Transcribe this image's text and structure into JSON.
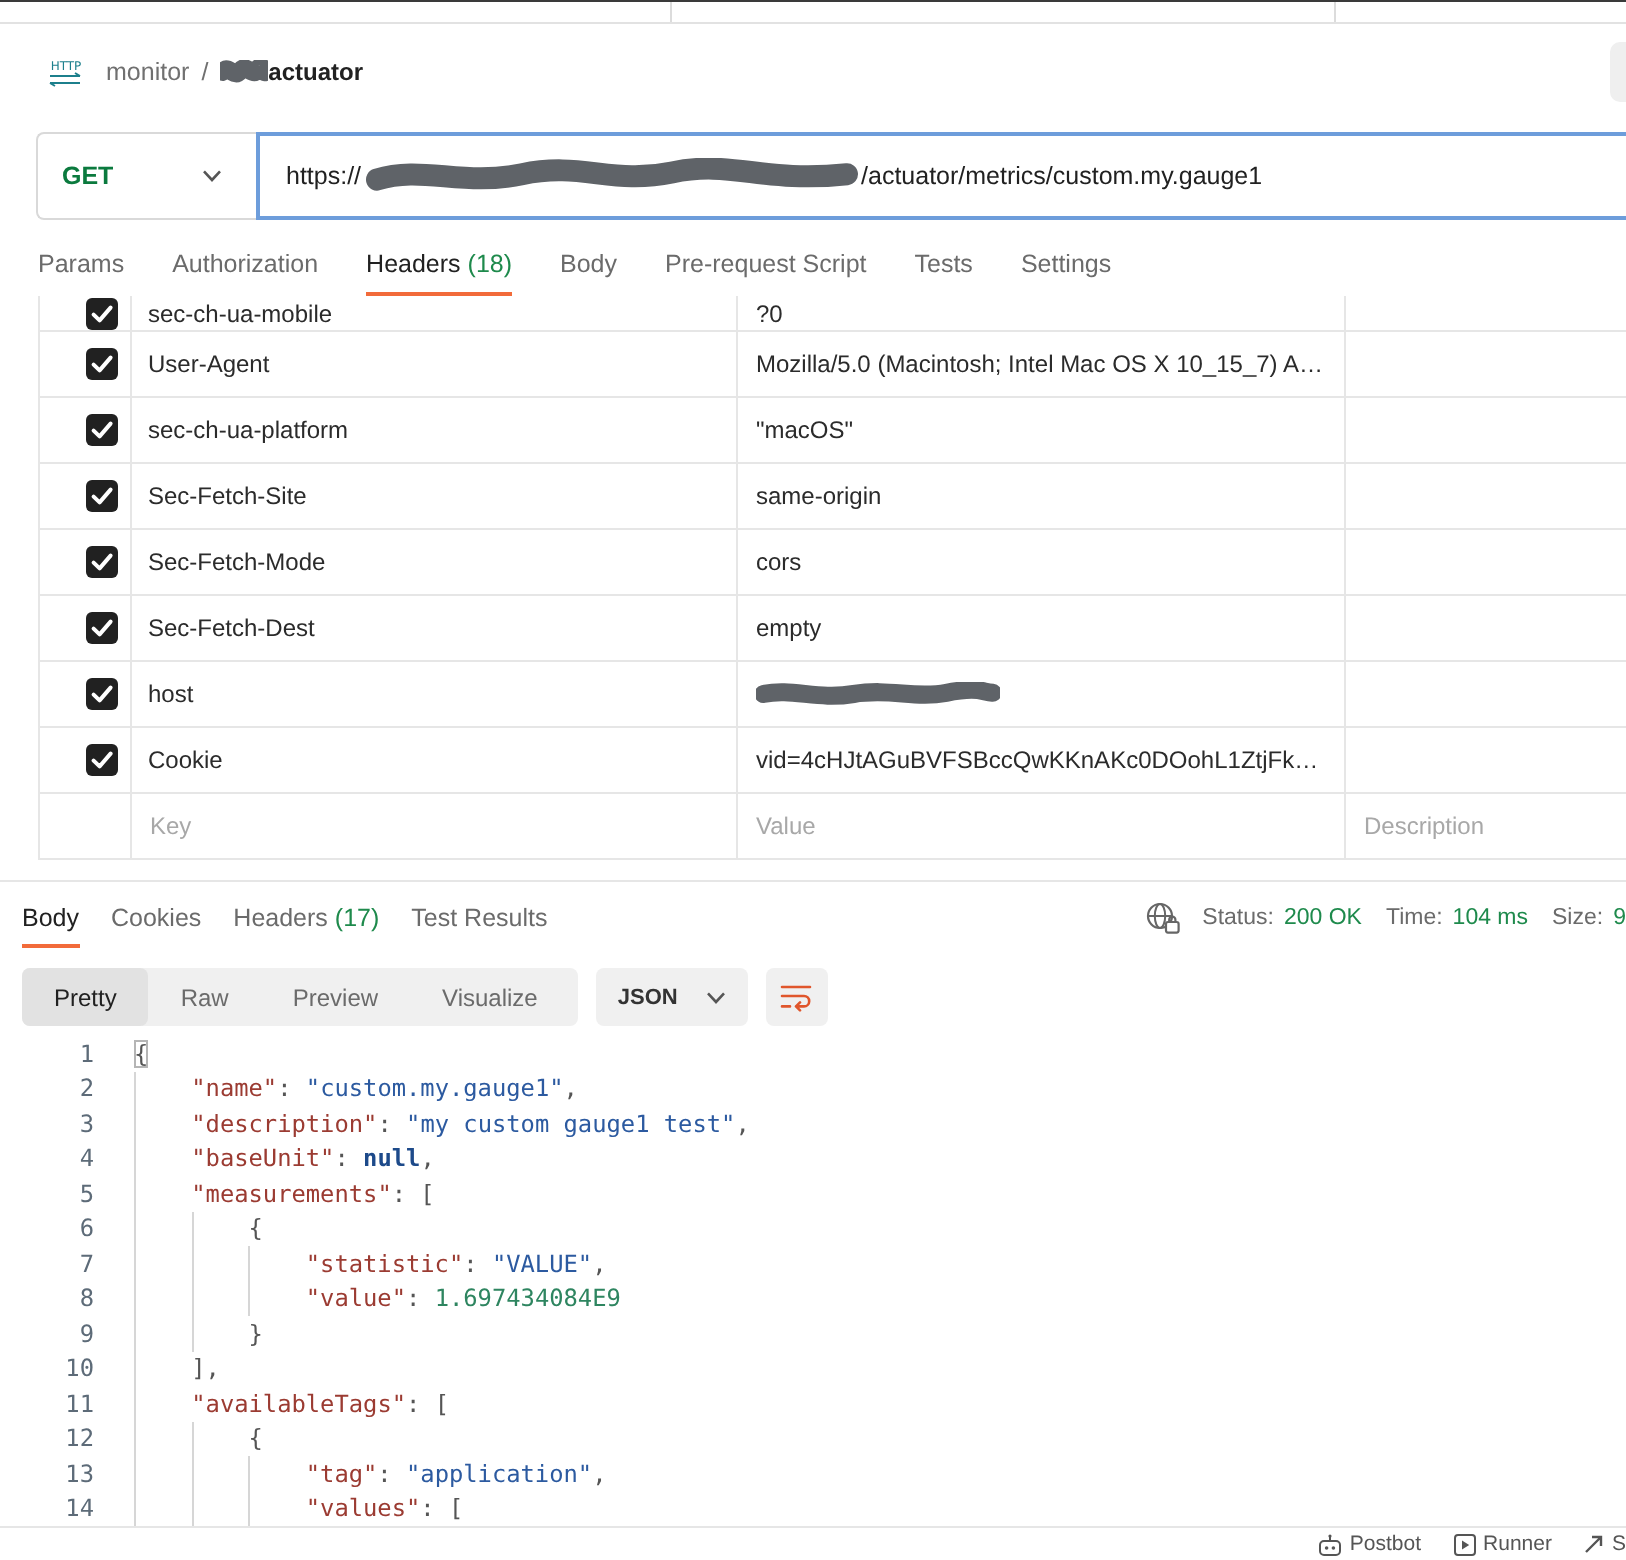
{
  "breadcrumb": {
    "icon_text": "HTTP",
    "collection": "monitor",
    "separator": "/",
    "request_redacted": true,
    "request": "actuator"
  },
  "request": {
    "method": "GET",
    "url_start": "https://",
    "url_redacted": true,
    "url_end": "/actuator/metrics/custom.my.gauge1"
  },
  "request_tabs": [
    {
      "label": "Params",
      "selected": false
    },
    {
      "label": "Authorization",
      "selected": false
    },
    {
      "label": "Headers",
      "count": "(18)",
      "selected": true
    },
    {
      "label": "Body",
      "selected": false
    },
    {
      "label": "Pre-request Script",
      "selected": false
    },
    {
      "label": "Tests",
      "selected": false
    },
    {
      "label": "Settings",
      "selected": false
    }
  ],
  "headers": {
    "rows": [
      {
        "checked": true,
        "key": "sec-ch-ua-mobile",
        "value": "?0",
        "redacted": false
      },
      {
        "checked": true,
        "key": "User-Agent",
        "value": "Mozilla/5.0 (Macintosh; Intel Mac OS X 10_15_7) A…",
        "redacted": false
      },
      {
        "checked": true,
        "key": "sec-ch-ua-platform",
        "value": "\"macOS\"",
        "redacted": false
      },
      {
        "checked": true,
        "key": "Sec-Fetch-Site",
        "value": "same-origin",
        "redacted": false
      },
      {
        "checked": true,
        "key": "Sec-Fetch-Mode",
        "value": "cors",
        "redacted": false
      },
      {
        "checked": true,
        "key": "Sec-Fetch-Dest",
        "value": "empty",
        "redacted": false
      },
      {
        "checked": true,
        "key": "host",
        "redacted": true
      },
      {
        "checked": true,
        "key": "Cookie",
        "value": "vid=4cHJtAGuBVFSBccQwKKnAKc0DOohL1ZtjFk…",
        "redacted": false
      }
    ],
    "new_row": {
      "key": {
        "placeholder": "Key"
      },
      "value": {
        "placeholder": "Value"
      },
      "description": {
        "placeholder": "Description"
      }
    }
  },
  "response": {
    "tabs": [
      {
        "label": "Body",
        "selected": true
      },
      {
        "label": "Cookies",
        "selected": false
      },
      {
        "label": "Headers",
        "count": "(17)",
        "selected": false
      },
      {
        "label": "Test Results",
        "selected": false
      }
    ],
    "stats": [
      {
        "label": "Status:",
        "value": "200 OK"
      },
      {
        "label": "Time:",
        "value": "104 ms"
      },
      {
        "label": "Size:",
        "value": "9"
      }
    ],
    "view_modes": [
      {
        "label": "Pretty",
        "selected": true
      },
      {
        "label": "Raw",
        "selected": false
      },
      {
        "label": "Preview",
        "selected": false
      },
      {
        "label": "Visualize",
        "selected": false
      }
    ],
    "format": "JSON",
    "code": [
      {
        "number": "1",
        "tokens": [
          {
            "kind": "match",
            "text": "{"
          }
        ],
        "children": [
          {
            "number": "2",
            "tokens": [
              {
                "kind": "key",
                "text": "\"name\""
              },
              {
                "kind": "punct",
                "text": ": "
              },
              {
                "kind": "string",
                "text": "\"custom.my.gauge1\""
              },
              {
                "kind": "punct",
                "text": ","
              }
            ]
          },
          {
            "number": "3",
            "tokens": [
              {
                "kind": "key",
                "text": "\"description\""
              },
              {
                "kind": "punct",
                "text": ": "
              },
              {
                "kind": "string",
                "text": "\"my custom gauge1 test\""
              },
              {
                "kind": "punct",
                "text": ","
              }
            ]
          },
          {
            "number": "4",
            "tokens": [
              {
                "kind": "key",
                "text": "\"baseUnit\""
              },
              {
                "kind": "punct",
                "text": ": "
              },
              {
                "kind": "null",
                "text": "null"
              },
              {
                "kind": "punct",
                "text": ","
              }
            ]
          },
          {
            "number": "5",
            "tokens": [
              {
                "kind": "key",
                "text": "\"measurements\""
              },
              {
                "kind": "punct",
                "text": ": ["
              }
            ],
            "children": [
              {
                "number": "6",
                "tokens": [
                  {
                    "kind": "punct",
                    "text": "{"
                  }
                ],
                "children": [
                  {
                    "number": "7",
                    "tokens": [
                      {
                        "kind": "key",
                        "text": "\"statistic\""
                      },
                      {
                        "kind": "punct",
                        "text": ": "
                      },
                      {
                        "kind": "string",
                        "text": "\"VALUE\""
                      },
                      {
                        "kind": "punct",
                        "text": ","
                      }
                    ]
                  },
                  {
                    "number": "8",
                    "tokens": [
                      {
                        "kind": "key",
                        "text": "\"value\""
                      },
                      {
                        "kind": "punct",
                        "text": ": "
                      },
                      {
                        "kind": "number",
                        "text": "1.697434084E9"
                      }
                    ]
                  }
                ]
              },
              {
                "number": "9",
                "tokens": [
                  {
                    "kind": "punct",
                    "text": "}"
                  }
                ]
              }
            ]
          },
          {
            "number": "10",
            "tokens": [
              {
                "kind": "punct",
                "text": "],"
              }
            ]
          },
          {
            "number": "11",
            "tokens": [
              {
                "kind": "key",
                "text": "\"availableTags\""
              },
              {
                "kind": "punct",
                "text": ": ["
              }
            ],
            "children": [
              {
                "number": "12",
                "tokens": [
                  {
                    "kind": "punct",
                    "text": "{"
                  }
                ],
                "children": [
                  {
                    "number": "13",
                    "tokens": [
                      {
                        "kind": "key",
                        "text": "\"tag\""
                      },
                      {
                        "kind": "punct",
                        "text": ": "
                      },
                      {
                        "kind": "string",
                        "text": "\"application\""
                      },
                      {
                        "kind": "punct",
                        "text": ","
                      }
                    ]
                  },
                  {
                    "number": "14",
                    "tokens": [
                      {
                        "kind": "key",
                        "text": "\"values\""
                      },
                      {
                        "kind": "punct",
                        "text": ": ["
                      }
                    ]
                  }
                ]
              }
            ]
          }
        ]
      }
    ]
  },
  "footer": {
    "items": [
      {
        "label": "Postbot"
      },
      {
        "label": "Runner"
      },
      {
        "label": "S"
      }
    ]
  }
}
